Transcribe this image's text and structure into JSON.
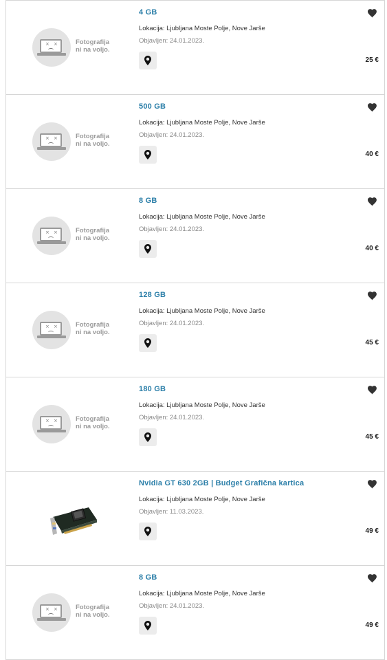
{
  "listings": [
    {
      "title": "4 GB",
      "location": "Lokacija: Ljubljana Moste Polje, Nove Jarše",
      "published": "Objavljen: 24.01.2023.",
      "price": "25 €",
      "image_placeholder": "Fotografija ni na voljo."
    },
    {
      "title": "500 GB",
      "location": "Lokacija: Ljubljana Moste Polje, Nove Jarše",
      "published": "Objavljen: 24.01.2023.",
      "price": "40 €",
      "image_placeholder": "Fotografija ni na voljo."
    },
    {
      "title": "8 GB",
      "location": "Lokacija: Ljubljana Moste Polje, Nove Jarše",
      "published": "Objavljen: 24.01.2023.",
      "price": "40 €",
      "image_placeholder": "Fotografija ni na voljo."
    },
    {
      "title": "128 GB",
      "location": "Lokacija: Ljubljana Moste Polje, Nove Jarše",
      "published": "Objavljen: 24.01.2023.",
      "price": "45 €",
      "image_placeholder": "Fotografija ni na voljo."
    },
    {
      "title": "180 GB",
      "location": "Lokacija: Ljubljana Moste Polje, Nove Jarše",
      "published": "Objavljen: 24.01.2023.",
      "price": "45 €",
      "image_placeholder": "Fotografija ni na voljo."
    },
    {
      "title": "Nvidia GT 630 2GB | Budget Grafična kartica",
      "location": "Lokacija: Ljubljana Moste Polje, Nove Jarše",
      "published": "Objavljen: 11.03.2023.",
      "price": "49 €",
      "image": "graphics-card-photo"
    },
    {
      "title": "8 GB",
      "location": "Lokacija: Ljubljana Moste Polje, Nove Jarše",
      "published": "Objavljen: 24.01.2023.",
      "price": "49 €",
      "image_placeholder": "Fotografija ni na voljo."
    }
  ],
  "colors": {
    "title": "#2a7ea8",
    "border": "#d6d6d6",
    "pin_bg": "#ececec"
  },
  "icons": {
    "favorite": "heart-icon",
    "map": "map-pin-icon",
    "no_photo": "no-photo-icon"
  }
}
